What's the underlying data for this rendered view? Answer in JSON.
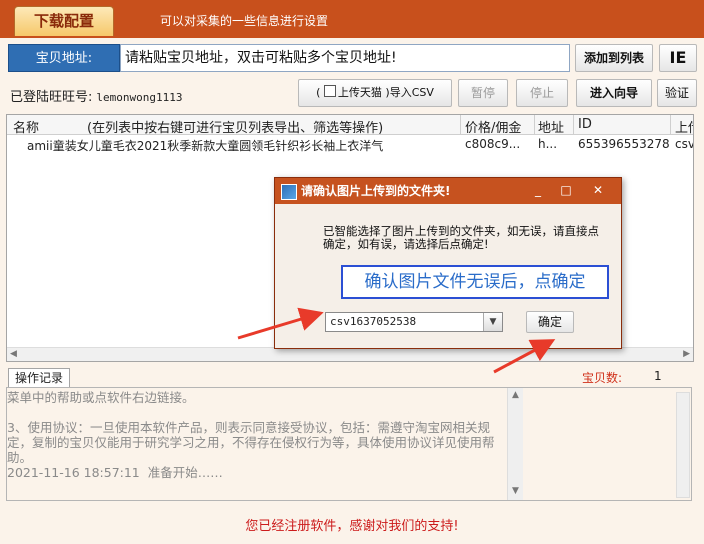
{
  "header": {
    "active_tab": "下载配置",
    "description": "可以对采集的一些信息进行设置"
  },
  "url_bar": {
    "label": "宝贝地址:",
    "value": "请粘贴宝贝地址，双击可粘贴多个宝贝地址!",
    "add_button": "添加到列表",
    "ie_button": "IE"
  },
  "toolbar": {
    "login_label": "已登陆旺旺号:",
    "login_user": "lemonwong1113",
    "import_prefix": "(",
    "tmall_checkbox": "上传天猫",
    "import_suffix": ")导入CSV",
    "pause": "暂停",
    "stop": "停止",
    "wizard": "进入向导",
    "verify": "验证"
  },
  "table": {
    "columns": [
      "名称",
      "(在列表中按右键可进行宝贝列表导出、筛选等操作)",
      "价格/佣金",
      "地址",
      "ID",
      "上传"
    ],
    "rows": [
      {
        "name": "amii童装女儿童毛衣2021秋季新款大童圆领毛针织衫长袖上衣洋气",
        "price": "c808c9...",
        "address": "h...",
        "id": "655396553278",
        "upload": "csv"
      }
    ]
  },
  "log": {
    "tab": "操作记录",
    "count_label": "宝贝数:",
    "count_value": "1",
    "lines": [
      "菜单中的帮助或点软件右边链接。",
      "",
      "3、使用协议：一旦使用本软件产品，则表示同意接受协议，包括：需遵守淘宝网相关规定，复制的宝贝仅能用于研究学习之用，不得存在侵权行为等，具体使用协议详见使用帮助。",
      "2021-11-16 18:57:11  准备开始……"
    ]
  },
  "footer": "您已经注册软件，感谢对我们的支持!",
  "dialog": {
    "title": "请确认图片上传到的文件夹!",
    "message": "已智能选择了图片上传到的文件夹，如无误，请直接点确定，如有误，请选择后点确定!",
    "note": "确认图片文件无误后，点确定",
    "folder_value": "csv1637052538",
    "ok_button": "确定",
    "minimize": "_",
    "maximize": "□",
    "close": "✕"
  },
  "colors": {
    "header": "#c8501c",
    "url_label": "#2f6eb3",
    "arrow": "#e83a2a",
    "note_border": "#2b4fd4"
  }
}
